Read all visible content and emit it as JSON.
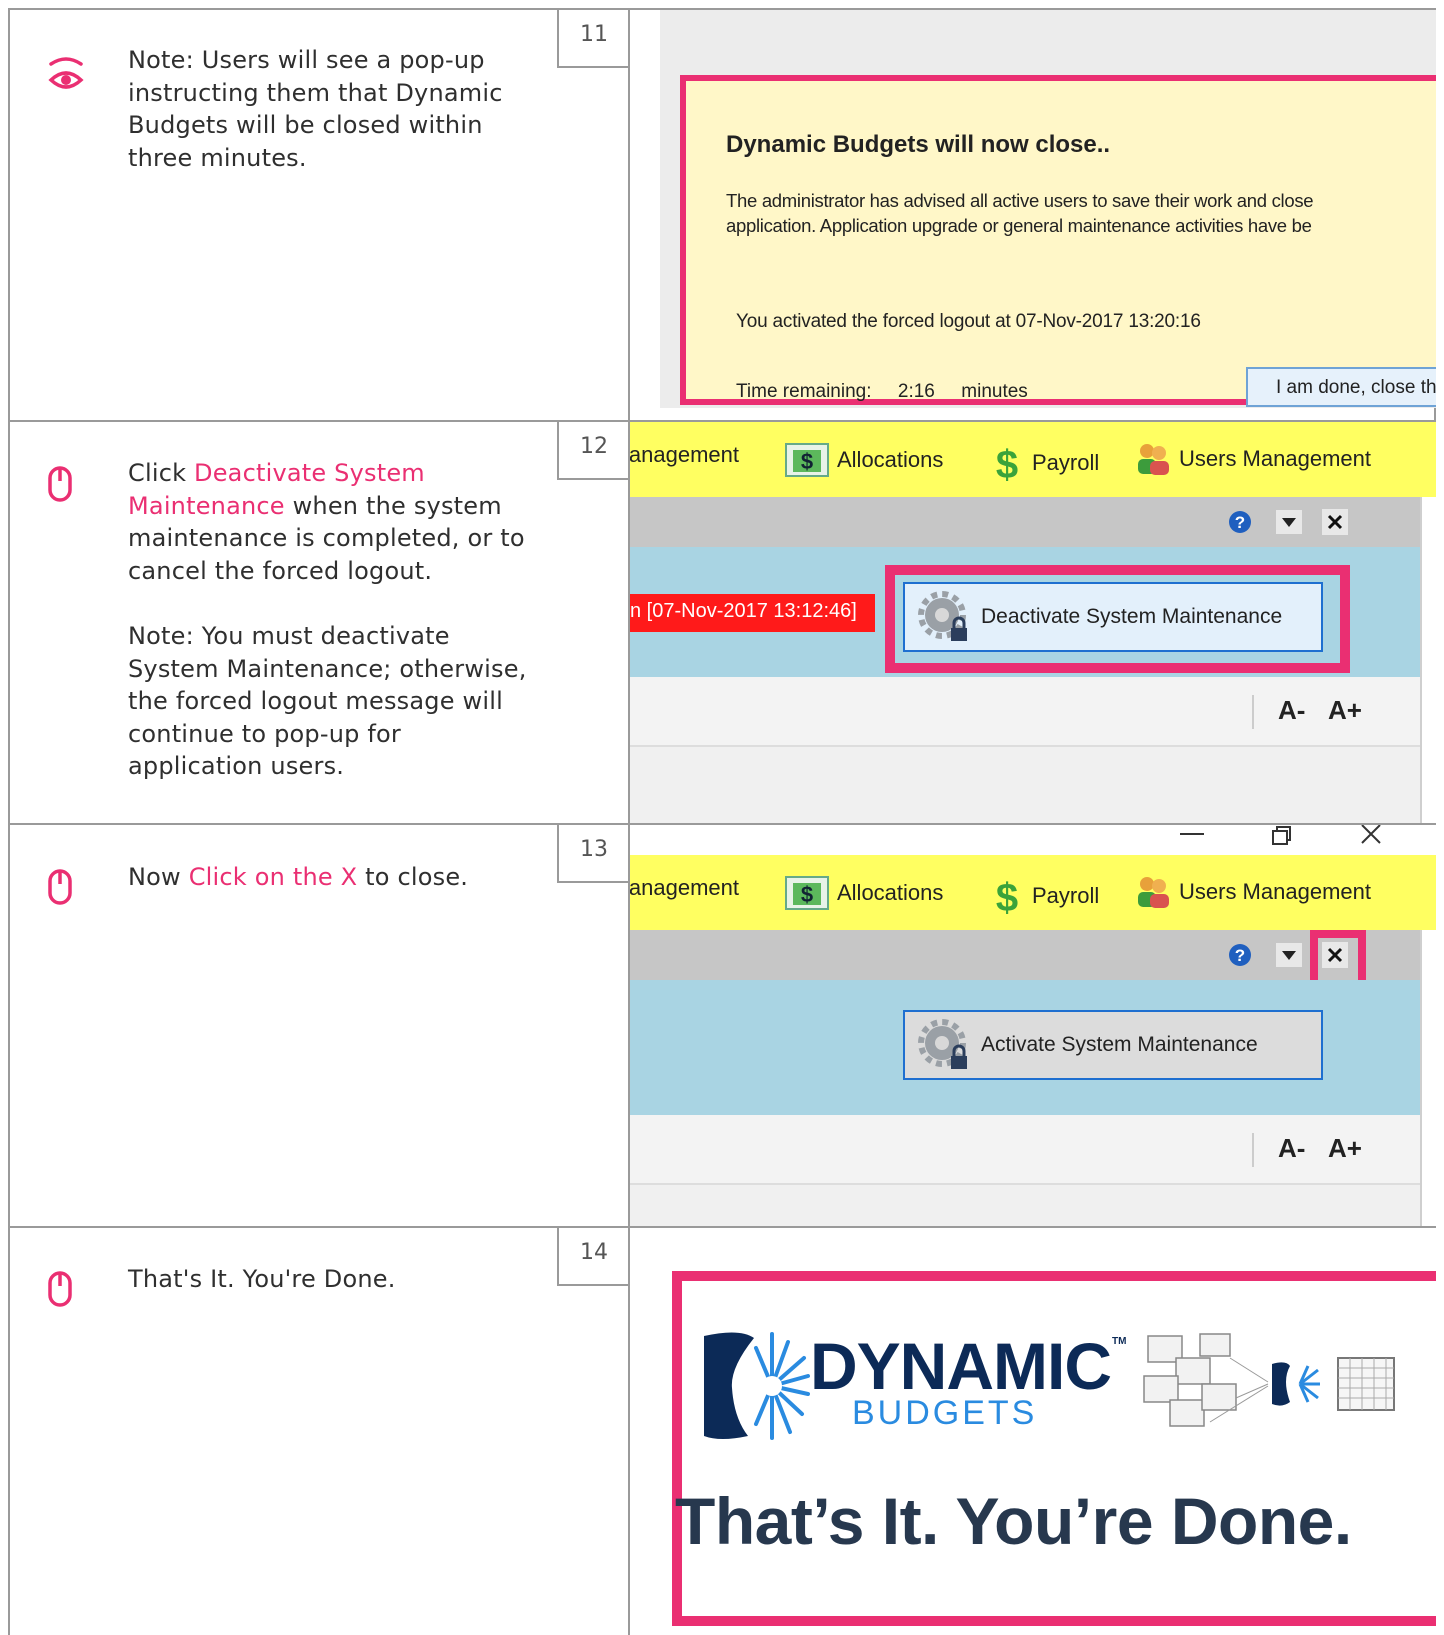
{
  "steps": [
    {
      "number": "11",
      "icon": "eye-icon",
      "paragraphs": [
        "Note: Users will see a pop-up instructing them that Dynamic Budgets will be closed within three minutes."
      ],
      "popup": {
        "title": "Dynamic Budgets will now close..",
        "body_line1": "The administrator has advised all active users to save their work and close",
        "body_line2": "application. Application upgrade or general maintenance activities have be",
        "activated": "You activated the forced logout at 07-Nov-2017 13:20:16",
        "remaining": "Time remaining:     2:16     minutes",
        "button": "I am done, close th"
      }
    },
    {
      "number": "12",
      "icon": "mouse-icon",
      "text_before": "Click ",
      "highlight": "Deactivate System Maintenance",
      "text_after": " when the system maintenance is completed, or to cancel the forced logout.",
      "note": "Note: You must deactivate System Maintenance; otherwise, the forced logout message will continue to pop-up for application users.",
      "status": "n [07-Nov-2017 13:12:46]",
      "button": "Deactivate System Maintenance"
    },
    {
      "number": "13",
      "icon": "mouse-icon",
      "text_before": "Now ",
      "highlight": "Click on the X",
      "text_after": " to close.",
      "button": "Activate System Maintenance"
    },
    {
      "number": "14",
      "icon": "mouse-icon",
      "text": "That's It. You're Done.",
      "logo_main": "DYNAMIC",
      "logo_tm": "TM",
      "logo_sub": "BUDGETS",
      "banner": "That’s It. You’re Done."
    }
  ],
  "toolbar": {
    "management": "lanagement",
    "allocations": "Allocations",
    "payroll": "Payroll",
    "users": "Users Management"
  },
  "font_controls": {
    "decrease": "A-",
    "increase": "A+"
  },
  "colors": {
    "accent": "#ea2f72",
    "toolbar": "#ffff61",
    "panel": "#a9d4e3",
    "status": "#ff1a1a"
  }
}
